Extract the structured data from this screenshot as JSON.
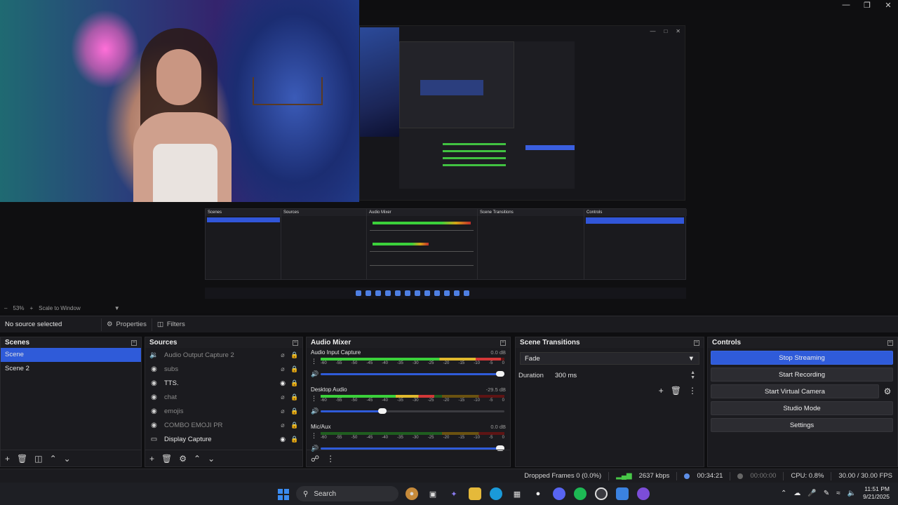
{
  "preview": {
    "zoom": "53%",
    "scale_mode": "Scale to Window",
    "nested_scene_label": "Scene",
    "nested_scene_label2": "Scene 2"
  },
  "source_bar": {
    "status": "No source selected",
    "properties_label": "Properties",
    "filters_label": "Filters"
  },
  "scenes": {
    "title": "Scenes",
    "items": [
      {
        "label": "Scene",
        "active": true
      },
      {
        "label": "Scene 2",
        "active": false
      }
    ]
  },
  "sources": {
    "title": "Sources",
    "items": [
      {
        "label": "Audio Output Capture 2",
        "icon": "speaker-icon",
        "visible": false
      },
      {
        "label": "subs",
        "icon": "browser-icon",
        "visible": false
      },
      {
        "label": "TTS.",
        "icon": "browser-icon",
        "visible": true
      },
      {
        "label": "chat",
        "icon": "browser-icon",
        "visible": false
      },
      {
        "label": "emojis",
        "icon": "browser-icon",
        "visible": false
      },
      {
        "label": "COMBO EMOJI PR",
        "icon": "browser-icon",
        "visible": false
      },
      {
        "label": "Display Capture",
        "icon": "monitor-icon",
        "visible": true
      }
    ]
  },
  "mixer": {
    "title": "Audio Mixer",
    "ticks": [
      "-60",
      "-55",
      "-50",
      "-45",
      "-40",
      "-35",
      "-30",
      "-25",
      "-20",
      "-15",
      "-10",
      "-5",
      "0"
    ],
    "channels": [
      {
        "name": "Audio Input Capture",
        "db": "0.0 dB",
        "level": 0.98,
        "volume": 1.0
      },
      {
        "name": "Desktop Audio",
        "db": "-29.5 dB",
        "level": 0.62,
        "volume": 0.36
      },
      {
        "name": "Mic/Aux",
        "db": "0.0 dB",
        "level": 0.0,
        "volume": 1.0
      }
    ]
  },
  "transitions": {
    "title": "Scene Transitions",
    "selected": "Fade",
    "duration_label": "Duration",
    "duration_value": "300 ms"
  },
  "controls": {
    "title": "Controls",
    "stop_streaming": "Stop Streaming",
    "start_recording": "Start Recording",
    "start_virtual_camera": "Start Virtual Camera",
    "studio_mode": "Studio Mode",
    "settings": "Settings"
  },
  "status": {
    "dropped_frames": "Dropped Frames 0 (0.0%)",
    "bitrate": "2637 kbps",
    "live_time": "00:34:21",
    "rec_time": "00:00:00",
    "cpu": "CPU: 0.8%",
    "fps": "30.00 / 30.00 FPS"
  },
  "taskbar": {
    "search_placeholder": "Search",
    "time": "11:51 PM",
    "date": "9/21/2025"
  }
}
